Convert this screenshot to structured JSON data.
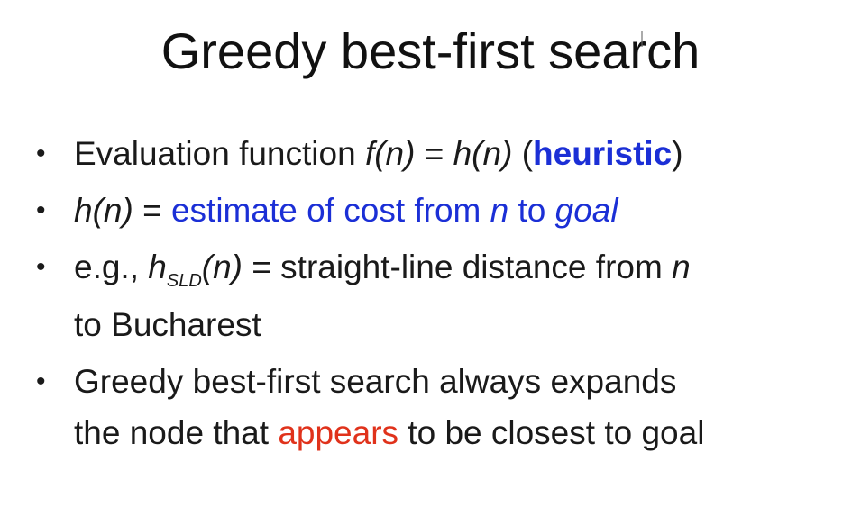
{
  "title": "Greedy best-first search",
  "bullets": {
    "b1": {
      "t1": "Evaluation function ",
      "t2": "f(n)",
      "t3": " = ",
      "t4": "h(n)",
      "t5": " (",
      "t6": "heuristic",
      "t7": ")"
    },
    "b2": {
      "t1": "h(n)",
      "t2": " = ",
      "t3": "estimate of cost from ",
      "t4": "n",
      "t5": " to ",
      "t6": "goal"
    },
    "b3": {
      "t1": "e.g., ",
      "t2": "h",
      "t3": "SLD",
      "t4": "(n)",
      "t5": " = straight-line distance from ",
      "t6": "n",
      "t7": "to Bucharest"
    },
    "b4": {
      "t1": "Greedy best-first search always expands",
      "t2": "the node that ",
      "t3": "appears",
      "t4": " to be closest to goal"
    }
  },
  "colors": {
    "emphasis_blue": "#1b2fd6",
    "emphasis_red": "#e0321b",
    "text": "#1a1a1a",
    "background": "#ffffff"
  }
}
